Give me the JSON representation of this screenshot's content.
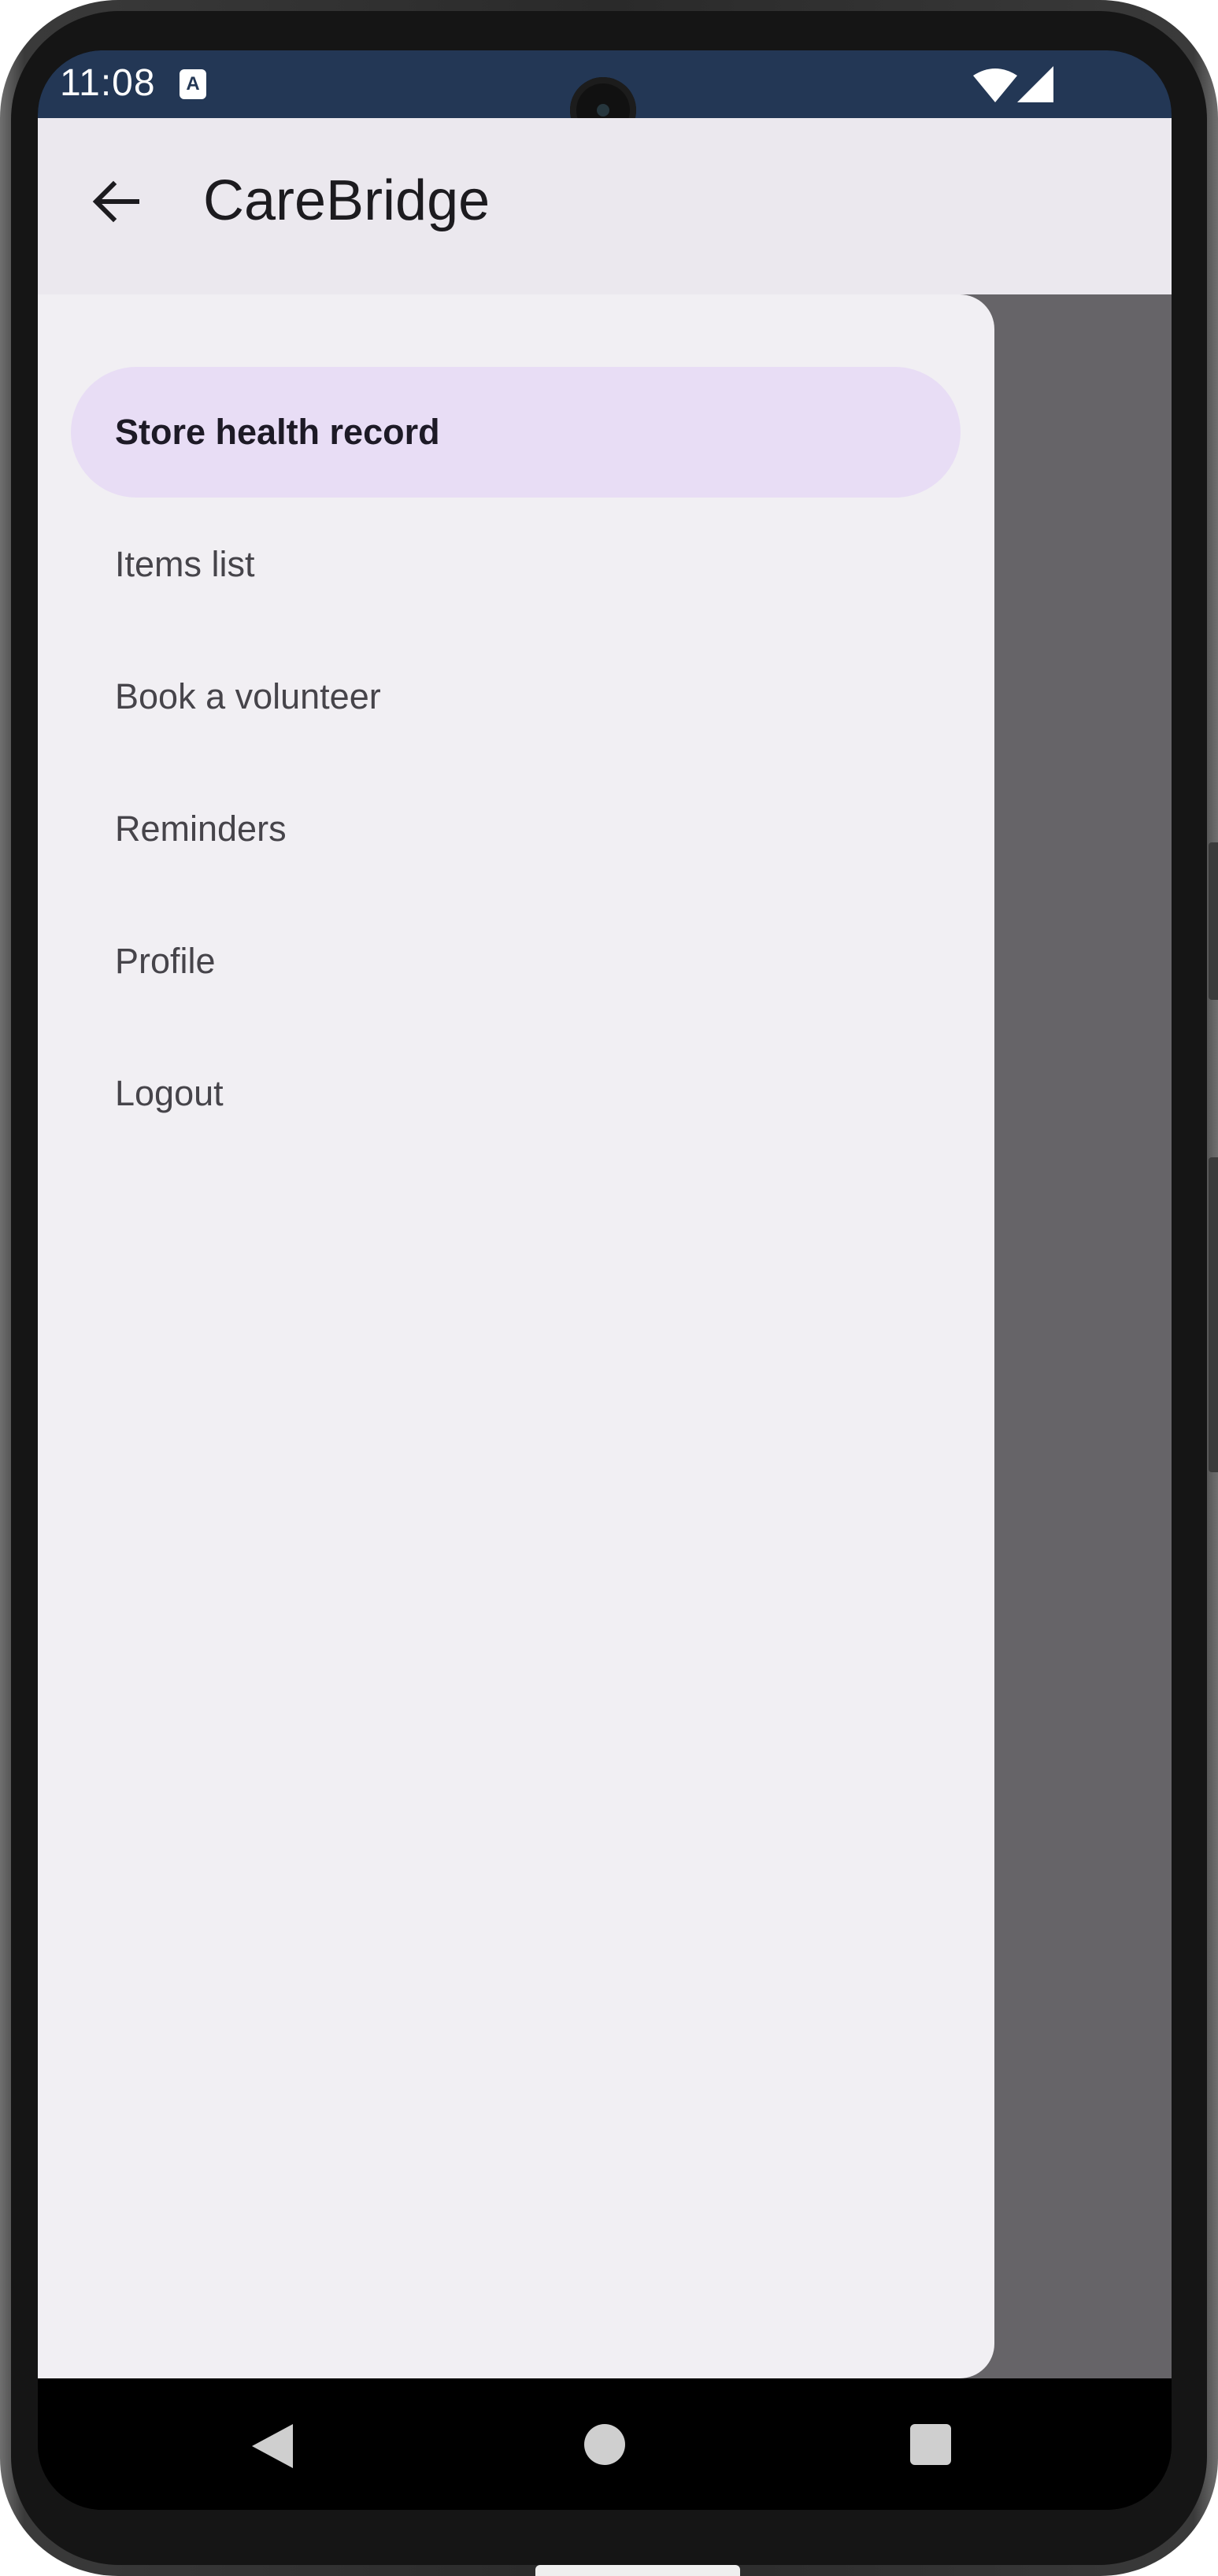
{
  "status_bar": {
    "time": "11:08",
    "notification_icon": "A",
    "icons": [
      "wifi-icon",
      "signal-icon"
    ]
  },
  "app_bar": {
    "title": "CareBridge",
    "back_icon": "arrow-back-icon"
  },
  "drawer": {
    "items": [
      {
        "label": "Store health record",
        "active": true
      },
      {
        "label": "Items list",
        "active": false
      },
      {
        "label": "Book a volunteer",
        "active": false
      },
      {
        "label": "Reminders",
        "active": false
      },
      {
        "label": "Profile",
        "active": false
      },
      {
        "label": "Logout",
        "active": false
      }
    ]
  },
  "nav_bar": {
    "buttons": [
      "back-triangle-icon",
      "home-circle-icon",
      "recents-square-icon"
    ]
  },
  "colors": {
    "status_bar": "#233755",
    "app_bar": "#ebe8ee",
    "drawer": "#f1eff3",
    "active_item": "#e8ddf5",
    "scrim": "#666468"
  }
}
